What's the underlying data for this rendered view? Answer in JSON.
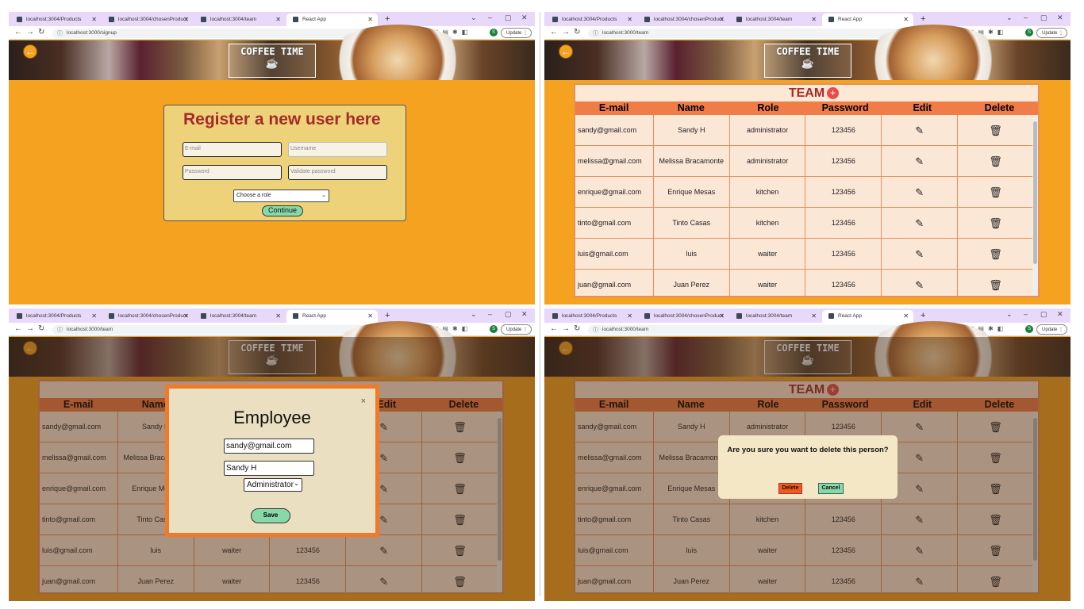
{
  "tabs": [
    "localhost:3004/Products",
    "localhost:3004/chosenProduct",
    "localhost:3004/team",
    "React App"
  ],
  "browser": {
    "update_label": "Update",
    "avatar_letter": "S"
  },
  "urls": {
    "signup": "localhost:3000/signup",
    "team": "localhost:3000/team"
  },
  "logo": {
    "text": "COFFEE TIME"
  },
  "register": {
    "title": "Register a new user here",
    "email_placeholder": "E-mail",
    "username_placeholder": "Username",
    "password_placeholder": "Password",
    "validate_placeholder": "Validate password",
    "role_select": "Choose a role",
    "continue_label": "Continue"
  },
  "team": {
    "title": "TEAM",
    "headers": [
      "E-mail",
      "Name",
      "Role",
      "Password",
      "Edit",
      "Delete"
    ],
    "rows": [
      [
        "sandy@gmail.com",
        "Sandy H",
        "administrator",
        "123456"
      ],
      [
        "melissa@gmail.com",
        "Melissa Bracamonte",
        "administrator",
        "123456"
      ],
      [
        "enrique@gmail.com",
        "Enrique Mesas",
        "kitchen",
        "123456"
      ],
      [
        "tinto@gmail.com",
        "Tinto Casas",
        "kitchen",
        "123456"
      ],
      [
        "luis@gmail.com",
        "luis",
        "waiter",
        "123456"
      ],
      [
        "juan@gmail.com",
        "Juan Perez",
        "waiter",
        "123456"
      ]
    ]
  },
  "employee_modal": {
    "title": "Employee",
    "email": "sandy@gmail.com",
    "name": "Sandy H",
    "role": "Administrator",
    "save_label": "Save",
    "close": "×"
  },
  "confirm_dialog": {
    "question": "Are you sure you want to delete this person?",
    "delete_label": "Delete",
    "cancel_label": "Cancel"
  }
}
